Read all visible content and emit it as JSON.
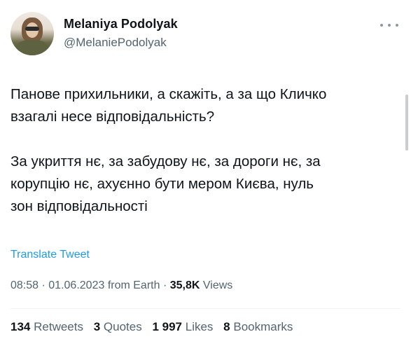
{
  "tweet": {
    "author_name": "Melaniya Podolyak",
    "author_handle": "@MelaniePodolyak",
    "text_line_1": "Панове прихильники, а скажіть, а за що Кличко",
    "text_line_2": "взагалі несе відповідальність?",
    "text_line_3": "За укриття нє, за забудову нє, за дороги нє, за",
    "text_line_4": "корупцію нє, ахуєнно бути мером Києва, нуль",
    "text_line_5": "зон відповідальності",
    "translate_label": "Translate Tweet",
    "time": "08:58",
    "date": "01.06.2023",
    "source": "from Earth",
    "views_count": "35,8K",
    "views_label": "Views"
  },
  "stats": {
    "retweets_count": "134",
    "retweets_label": "Retweets",
    "quotes_count": "3",
    "quotes_label": "Quotes",
    "likes_count": "1 997",
    "likes_label": "Likes",
    "bookmarks_count": "8",
    "bookmarks_label": "Bookmarks"
  },
  "icons": {
    "more": "more-horizontal-icon"
  }
}
